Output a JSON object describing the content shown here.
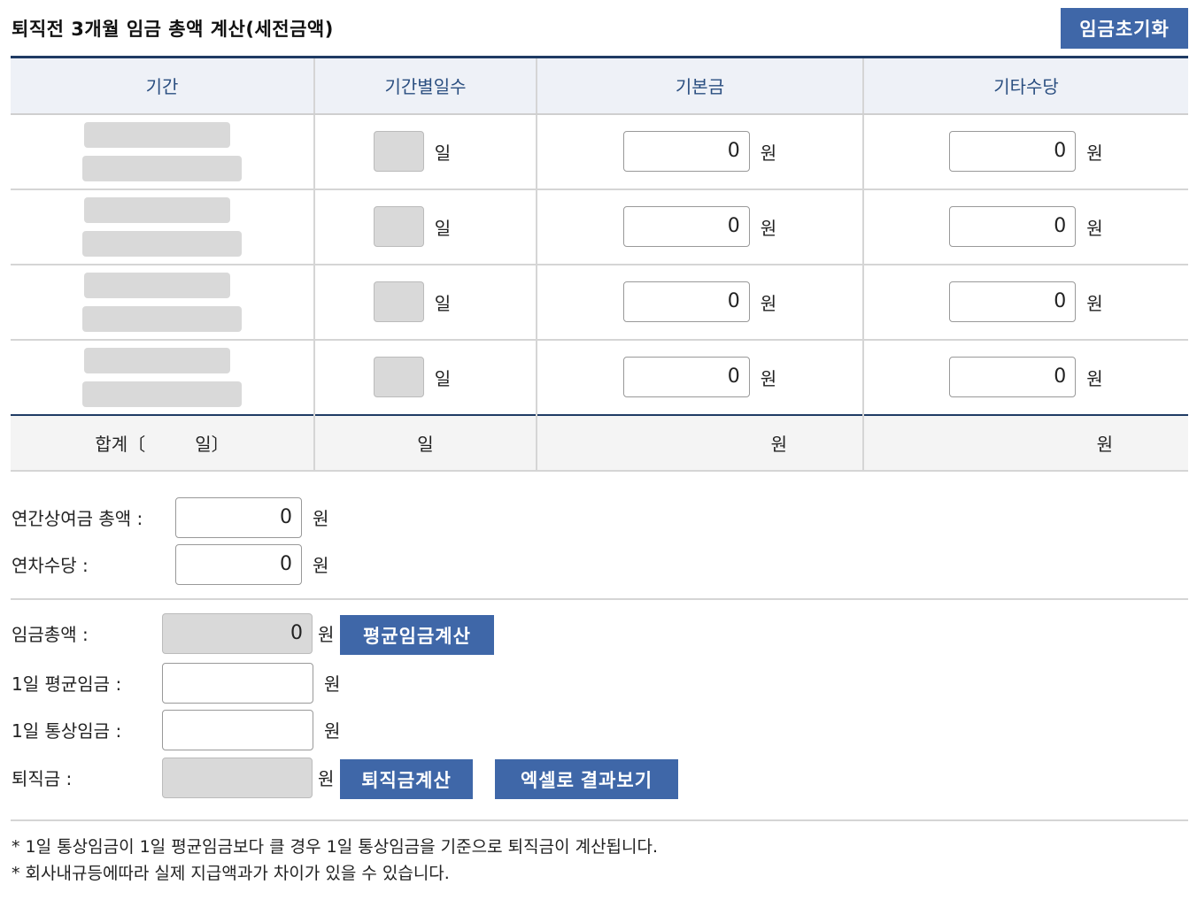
{
  "header": {
    "title": "퇴직전 3개월 임금 총액 계산(세전금액)",
    "reset_button": "임금초기화"
  },
  "table": {
    "columns": [
      "기간",
      "기간별일수",
      "기본금",
      "기타수당"
    ],
    "rows": [
      {
        "days_unit": "일",
        "basic": "0",
        "basic_unit": "원",
        "other": "0",
        "other_unit": "원"
      },
      {
        "days_unit": "일",
        "basic": "0",
        "basic_unit": "원",
        "other": "0",
        "other_unit": "원"
      },
      {
        "days_unit": "일",
        "basic": "0",
        "basic_unit": "원",
        "other": "0",
        "other_unit": "원"
      },
      {
        "days_unit": "일",
        "basic": "0",
        "basic_unit": "원",
        "other": "0",
        "other_unit": "원"
      }
    ],
    "summary": {
      "label_prefix": "합계〔",
      "label_suffix": "일〕",
      "days_unit": "일",
      "basic_unit": "원",
      "other_unit": "원"
    }
  },
  "extra": {
    "bonus_label": "연간상여금 총액 :",
    "bonus_value": "0",
    "bonus_unit": "원",
    "annual_leave_label": "연차수당 :",
    "annual_leave_value": "0",
    "annual_leave_unit": "원"
  },
  "results": {
    "total_wage_label": "임금총액 :",
    "total_wage_value": "0",
    "total_wage_unit": "원",
    "avg_wage_button": "평균임금계산",
    "daily_avg_label": "1일 평균임금 :",
    "daily_avg_value": "",
    "daily_avg_unit": "원",
    "daily_ordinary_label": "1일 통상임금 :",
    "daily_ordinary_value": "",
    "daily_ordinary_unit": "원",
    "severance_label": "퇴직금 :",
    "severance_value": "",
    "severance_unit": "원",
    "severance_button": "퇴직금계산",
    "excel_button": "엑셀로 결과보기"
  },
  "notes": [
    "* 1일 통상임금이 1일 평균임금보다 클 경우 1일 통상임금을 기준으로 퇴직금이 계산됩니다.",
    "* 회사내규등에따라 실제 지급액과가 차이가 있을 수 있습니다."
  ],
  "colors": {
    "accent": "#3f67a8",
    "header_bg": "#eef1f7",
    "header_text": "#2a4e80",
    "border_dark": "#1f3b64",
    "disabled_bg": "#d9d9d9"
  }
}
